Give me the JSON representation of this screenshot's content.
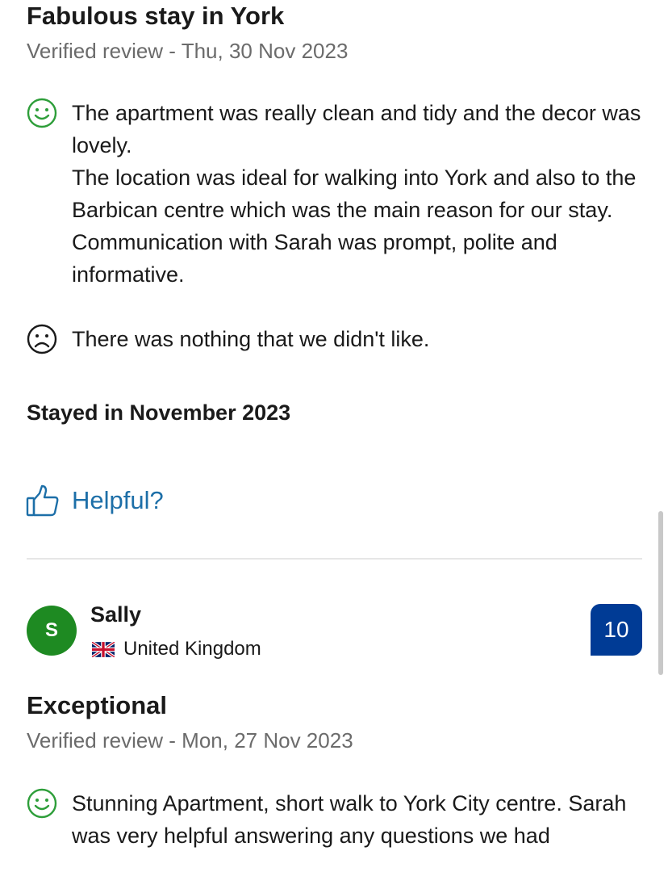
{
  "review1": {
    "title": "Fabulous stay in York",
    "meta": "Verified review - Thu, 30 Nov 2023",
    "liked": "The apartment was really clean and tidy and the decor was lovely.\nThe location was ideal for walking into York and also to the Barbican centre which was the main reason for our stay. Communication  with Sarah was prompt, polite and informative.",
    "disliked": "There was nothing that we didn't like.",
    "stayed": "Stayed in November 2023",
    "helpful_label": "Helpful?"
  },
  "review2": {
    "avatar_initial": "S",
    "reviewer_name": "Sally",
    "country": "United Kingdom",
    "flag_icon": "uk-flag-icon",
    "score": "10",
    "title": "Exceptional",
    "meta": "Verified review - Mon, 27 Nov 2023",
    "liked": "Stunning Apartment, short walk to York City centre. Sarah was very helpful answering any questions we had"
  },
  "colors": {
    "positive": "#2e9e3a",
    "negative": "#1a1a1a",
    "link": "#1d6fa8",
    "avatar": "#1e8a22",
    "score_badge": "#003b95"
  }
}
